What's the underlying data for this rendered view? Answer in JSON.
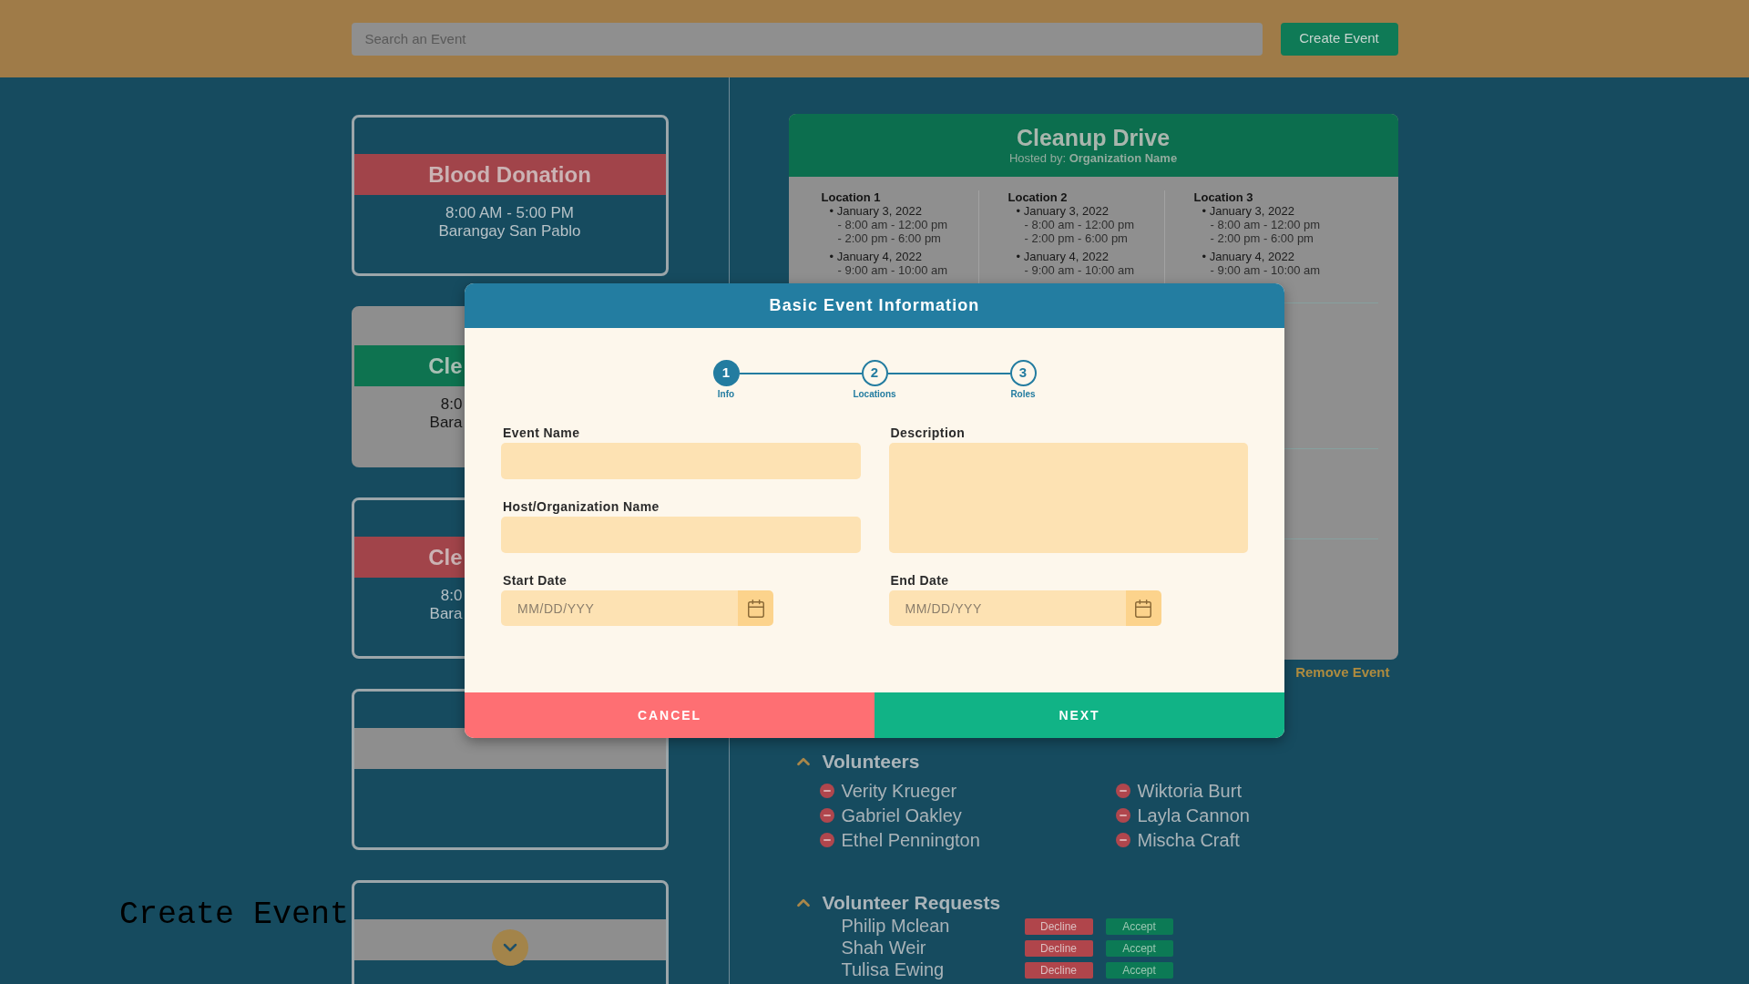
{
  "top_bar": {
    "search": {
      "placeholder": "Search an Event"
    },
    "create_button": "Create Event"
  },
  "event_list": [
    {
      "kind": "full",
      "selected": false,
      "color": "#a1444a",
      "title": "Blood Donation",
      "time": "8:00 AM - 5:00 PM",
      "place": "Barangay San Pablo"
    },
    {
      "kind": "covered",
      "selected": true,
      "color": "#0e7350",
      "title": "Cle",
      "time": "8:0",
      "place": "Bara"
    },
    {
      "kind": "covered",
      "selected": false,
      "color": "#a1444a",
      "title": "Cle",
      "time": "8:0",
      "place": "Bara"
    },
    {
      "kind": "empty",
      "selected": false,
      "color": "#8e8e8e"
    },
    {
      "kind": "empty",
      "selected": false,
      "color": "#8e8e8e"
    }
  ],
  "overlay_label": "Create Event",
  "event_detail": {
    "title": "Cleanup Drive",
    "host": "Hosted by: **Organization Name**",
    "locations": [
      {
        "name": "Location 1",
        "dates": [
          {
            "date": "• January 3, 2022",
            "times": [
              "- 8:00 am - 12:00 pm",
              "- 2:00 pm - 6:00 pm"
            ]
          },
          {
            "date": "• January 4, 2022",
            "times": [
              "- 9:00 am - 10:00 am"
            ]
          }
        ]
      },
      {
        "name": "Location 2",
        "dates": [
          {
            "date": "• January 3, 2022",
            "times": [
              "- 8:00 am - 12:00 pm",
              "- 2:00 pm - 6:00 pm"
            ]
          },
          {
            "date": "• January 4, 2022",
            "times": [
              "- 9:00 am - 10:00 am"
            ]
          }
        ]
      },
      {
        "name": "Location 3",
        "dates": [
          {
            "date": "• January 3, 2022",
            "times": [
              "- 8:00 am - 12:00 pm",
              "- 2:00 pm - 6:00 pm"
            ]
          },
          {
            "date": "• January 4, 2022",
            "times": [
              "- 9:00 am - 10:00 am"
            ]
          }
        ]
      }
    ]
  },
  "remove_link": "Remove Event",
  "volunteers": {
    "title": "Volunteers",
    "expanded": true,
    "names": [
      "Verity Krueger",
      "Gabriel Oakley",
      "Ethel Pennington",
      "Wiktoria Burt",
      "Layla Cannon",
      "Mischa Craft"
    ]
  },
  "volunteer_requests": {
    "title": "Volunteer Requests",
    "expanded": true,
    "rows": [
      {
        "name": "Philip Mclean",
        "decline": "Decline",
        "accept": "Accept"
      },
      {
        "name": "Shah Weir",
        "decline": "Decline",
        "accept": "Accept"
      },
      {
        "name": "Tulisa Ewing",
        "decline": "Decline",
        "accept": "Accept"
      }
    ]
  },
  "dialog": {
    "title": "Basic Event Information",
    "steps": [
      {
        "number": "1",
        "label": "Info",
        "selected": true
      },
      {
        "number": "2",
        "label": "Locations",
        "selected": false
      },
      {
        "number": "3",
        "label": "Roles",
        "selected": false
      }
    ],
    "form_columns": [
      [
        {
          "kind": "text",
          "label": "Event Name"
        },
        {
          "kind": "text",
          "label": "Host/Organization Name"
        },
        {
          "kind": "date",
          "label": "Start Date",
          "placeholder": "MM/DD/YYY"
        }
      ],
      [
        {
          "kind": "textarea",
          "label": "Description"
        },
        {
          "kind": "date",
          "label": "End Date",
          "placeholder": "MM/DD/YYY"
        }
      ]
    ],
    "cancel_button": "CANCEL",
    "next_button": "NEXT"
  }
}
